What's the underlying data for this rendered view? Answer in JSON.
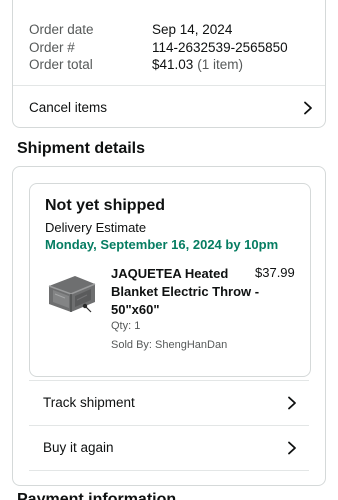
{
  "order_summary": {
    "rows": [
      {
        "label": "Order date",
        "value": "Sep 14, 2024",
        "extra": ""
      },
      {
        "label": "Order #",
        "value": "114-2632539-2565850",
        "extra": ""
      },
      {
        "label": "Order total",
        "value": "$41.03",
        "extra": "(1 item)"
      }
    ],
    "cancel_label": "Cancel items"
  },
  "shipment": {
    "section_title": "Shipment details",
    "status": "Not yet shipped",
    "delivery_label": "Delivery Estimate",
    "delivery_date": "Monday, September 16, 2024 by 10pm",
    "item": {
      "title": "JAQUETEA Heated Blanket Electric Throw - 50\"x60\"",
      "price": "$37.99",
      "qty": "Qty: 1",
      "sold_by": "Sold By: ShengHanDan"
    },
    "track_label": "Track shipment",
    "buy_again_label": "Buy it again"
  },
  "next_section": {
    "title": "Payment information"
  },
  "icons": {
    "chevron": "chevron-right-icon",
    "thumb": "blanket-product-image"
  },
  "colors": {
    "delivery_green": "#067d62",
    "border": "#d5d9d9",
    "muted": "#565959"
  }
}
